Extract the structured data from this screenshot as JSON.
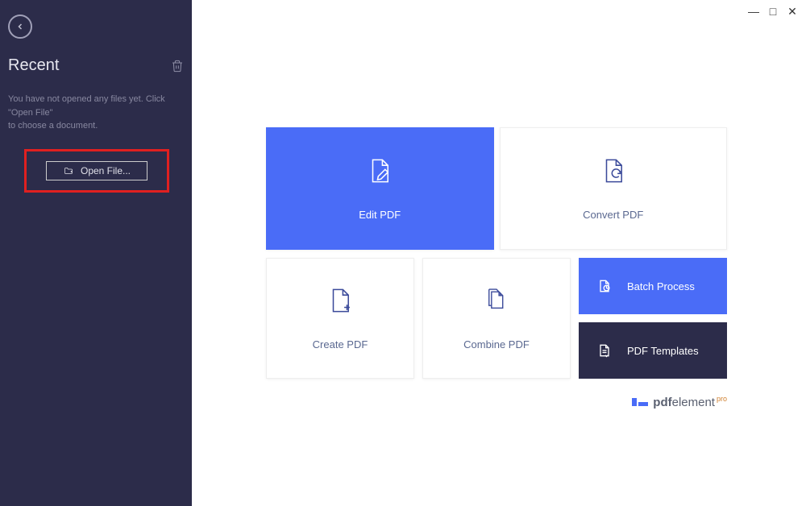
{
  "window_controls": {
    "minimize": "—",
    "maximize": "□",
    "close": "✕"
  },
  "sidebar": {
    "recent_title": "Recent",
    "hint_line1": "You have not opened any files yet. Click \"Open File\"",
    "hint_line2": "to choose a document.",
    "open_file_label": "Open File..."
  },
  "tiles": {
    "edit": "Edit PDF",
    "convert": "Convert PDF",
    "create": "Create PDF",
    "combine": "Combine PDF",
    "batch": "Batch Process",
    "templates": "PDF Templates"
  },
  "brand": {
    "prefix": "pdf",
    "suffix": "element",
    "pro": "pro"
  }
}
